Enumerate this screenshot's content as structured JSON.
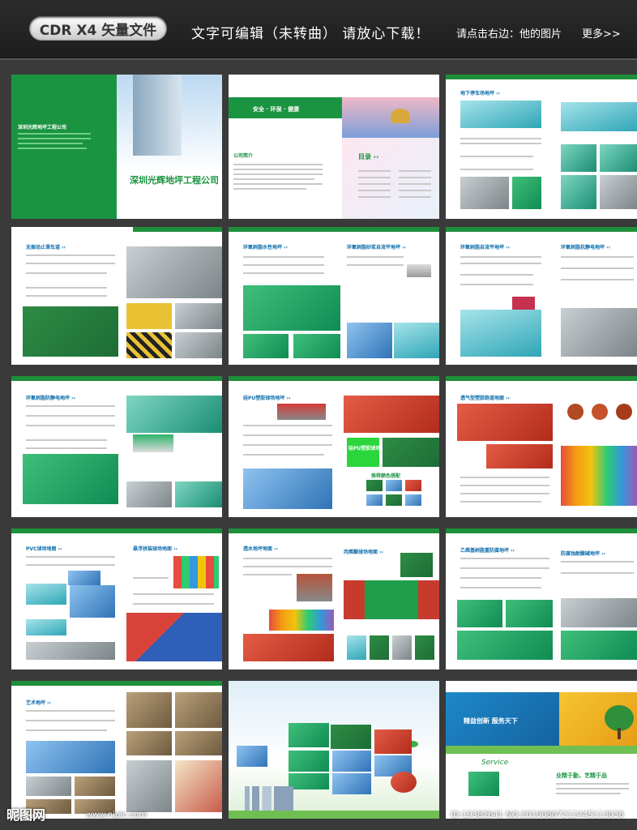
{
  "header": {
    "badge": "CDR X4 矢量文件",
    "slogan": "文字可编辑（未转曲）  请放心下载！",
    "hint": "请点击右边：他的图片",
    "more": "更多>>"
  },
  "pages": {
    "cover": {
      "company": "深圳光辉地坪工程公司"
    },
    "p2": {
      "banner": "安全 · 环保 · 健康",
      "profile": "公司简介",
      "contents": "目录 ››"
    },
    "p3": {
      "title": "地下停车场地坪 ››"
    },
    "p4": {
      "title": "无振动止滑车道 ››"
    },
    "p5a": {
      "title": "环氧树脂水性地坪 ››"
    },
    "p5b": {
      "title": "环氧树脂砂浆自流平地坪 ››"
    },
    "p6a": {
      "title": "环氧树脂自流平地坪 ››"
    },
    "p6b": {
      "title": "环氧树脂抗静电地坪 ››"
    },
    "p7": {
      "title": "环氧树脂防静电地坪 ››"
    },
    "p8": {
      "title": "硅PU塑胶球场地坪 ››",
      "pu": "硅PU塑胶球场",
      "color": "推荐颜色搭配"
    },
    "p9": {
      "title": "透气型塑胶跑道地面 ››"
    },
    "p10a": {
      "title": "PVC球场地面 ››"
    },
    "p10b": {
      "title": "悬浮拼装球场地面 ››"
    },
    "p11a": {
      "title": "透水地坪地面 ››"
    },
    "p11b": {
      "title": "丙烯酸球场地面 ››"
    },
    "p12a": {
      "title": "乙烯基树脂重防腐地坪 ››"
    },
    "p12b": {
      "title": "防腐蚀耐酸碱地坪 ››"
    },
    "p13": {
      "title": "艺术地坪 ››"
    },
    "back": {
      "slogan": "精益创新  服务天下",
      "service": "Service",
      "motto": "业精于勤，艺精于品"
    }
  },
  "watermark": {
    "logo": "昵图网",
    "url": "www.nipic.com",
    "id": "ID:19382641 NO:20190807212445113036"
  }
}
